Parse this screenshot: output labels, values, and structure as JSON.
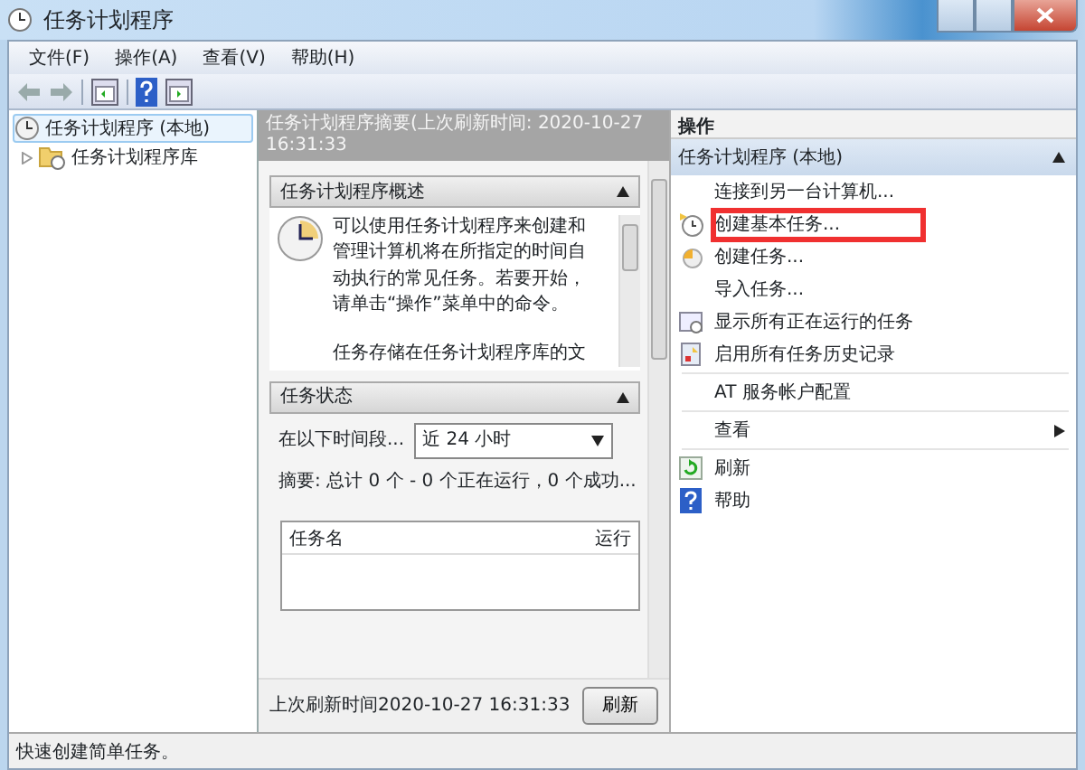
{
  "window": {
    "title": "任务计划程序"
  },
  "menu": [
    "文件(F)",
    "操作(A)",
    "查看(V)",
    "帮助(H)"
  ],
  "tree": [
    {
      "label": "任务计划程序 (本地)",
      "selected": true,
      "children": [
        {
          "label": "任务计划程序库",
          "expanded": false
        }
      ]
    }
  ],
  "summary_header": "任务计划程序摘要(上次刷新时间: 2020-10-27 16:31:33",
  "overview": {
    "title": "任务计划程序概述",
    "expanded": true,
    "lines": [
      "可以使用任务计划程序来创建和",
      "管理计算机将在所指定的时间自",
      "动执行的常见任务。若要开始，",
      "请单击“操作”菜单中的命令。",
      "任务存储在任务计划程序库的文"
    ]
  },
  "task_status": {
    "title": "任务状态",
    "expanded": true,
    "period_label": "在以下时间段...",
    "period_value": "近 24 小时",
    "summary": "摘要: 总计 0 个 - 0 个正在运行，0 个成功...",
    "columns": [
      "任务名",
      "运行"
    ]
  },
  "last_refresh": "上次刷新时间2020-10-27 16:31:33",
  "refresh_button": "刷新",
  "actions": {
    "title": "操作",
    "group_title": "任务计划程序 (本地)",
    "expanded": true,
    "groups": [
      [
        {
          "label": "连接到另一台计算机...",
          "kind": "item",
          "highlighted": false
        },
        {
          "label": "创建基本任务...",
          "kind": "item",
          "highlighted": true
        },
        {
          "label": "创建任务...",
          "kind": "item",
          "highlighted": false
        },
        {
          "label": "导入任务...",
          "kind": "item",
          "highlighted": false
        },
        {
          "label": "显示所有正在运行的任务",
          "kind": "item",
          "highlighted": false
        },
        {
          "label": "启用所有任务历史记录",
          "kind": "item",
          "highlighted": false
        }
      ],
      [
        {
          "label": "AT 服务帐户配置",
          "kind": "item",
          "highlighted": false
        }
      ],
      [
        {
          "label": "查看",
          "kind": "submenu",
          "highlighted": false
        }
      ],
      [
        {
          "label": "刷新",
          "kind": "item",
          "highlighted": false
        },
        {
          "label": "帮助",
          "kind": "item",
          "highlighted": false
        }
      ]
    ]
  },
  "status_bar": "快速创建简单任务。"
}
